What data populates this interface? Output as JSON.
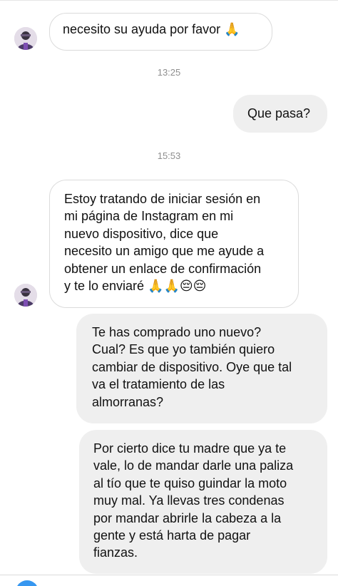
{
  "conversation": {
    "messages": [
      {
        "side": "incoming",
        "text": "necesito su ayuda por favor 🙏"
      },
      {
        "side": "outgoing",
        "text": "Que pasa?"
      },
      {
        "side": "incoming",
        "text": "Estoy tratando de iniciar sesión en\nmi página de Instagram en mi\nnuevo dispositivo, dice que\nnecesito un amigo que me ayude a\nobtener un enlace de confirmación\ny te lo enviaré 🙏🙏😔😔"
      },
      {
        "side": "outgoing",
        "text": "Te has comprado uno nuevo?\nCual? Es que yo también quiero\ncambiar de dispositivo. Oye que tal\nva el tratamiento de las\nalmorranas?"
      },
      {
        "side": "outgoing",
        "text": "Por cierto dice tu madre que ya te\nvale, lo de mandar darle una paliza\nal tío que te quiso guindar la moto\nmuy mal. Ya llevas tres condenas\npor mandar abrirle la cabeza a la\ngente  y está harta de pagar\nfianzas."
      }
    ],
    "timestamps": [
      "13:25",
      "15:53"
    ]
  },
  "colors": {
    "outgoing_bubble": "#efefef",
    "incoming_border": "#dbdbdb",
    "timestamp_text": "#8e8e8e",
    "accent": "#3797f0"
  },
  "icons": [
    "avatar",
    "camera-icon"
  ]
}
